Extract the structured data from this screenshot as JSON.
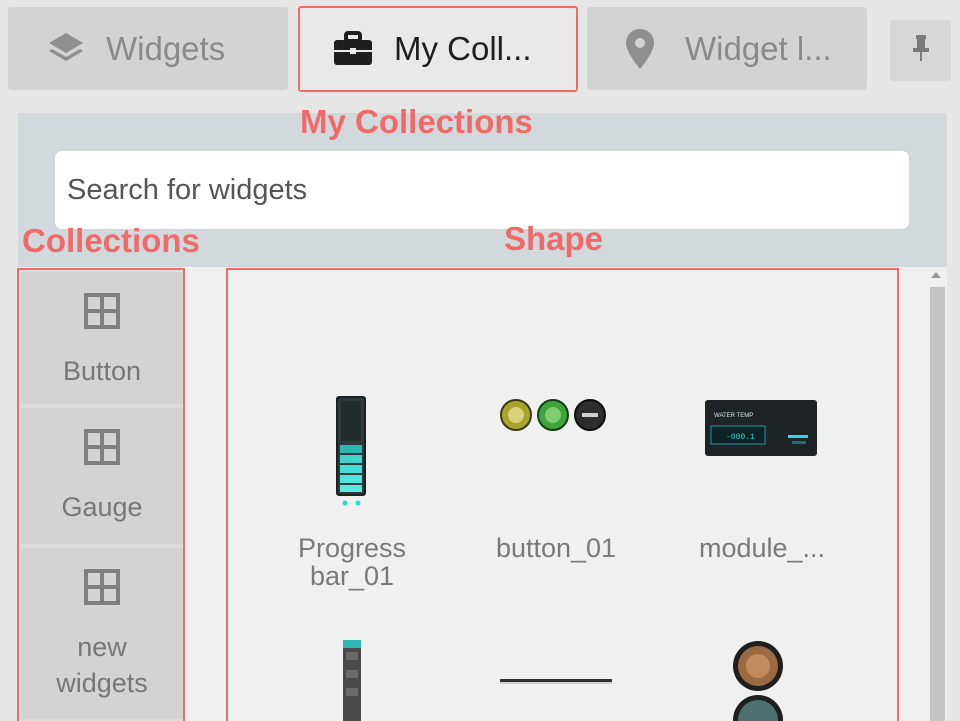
{
  "tabs": [
    {
      "label": "Widgets",
      "icon": "layers-icon"
    },
    {
      "label": "My Coll...",
      "icon": "briefcase-icon"
    },
    {
      "label": "Widget l...",
      "icon": "map-pin-icon"
    }
  ],
  "pin_icon": "pin-icon",
  "annotations": {
    "my_collections": "My Collections",
    "collections": "Collections",
    "shape": "Shape"
  },
  "search": {
    "placeholder": "Search for widgets"
  },
  "categories": [
    {
      "label": "Button",
      "icon": "grid-icon"
    },
    {
      "label": "Gauge",
      "icon": "grid-icon"
    },
    {
      "label": "new widgets",
      "icon": "grid-icon"
    }
  ],
  "widgets": [
    {
      "label": "Progress bar_01"
    },
    {
      "label": "button_01"
    },
    {
      "label": "module_..."
    }
  ],
  "module_screen": {
    "title": "WATER TEMP",
    "value": "-000.1"
  },
  "colors": {
    "accent_annotation": "#f16a6a",
    "panel_header": "#d2d9dd",
    "tab_inactive": "#d3d3d3",
    "tab_active": "#e9e9e9"
  }
}
